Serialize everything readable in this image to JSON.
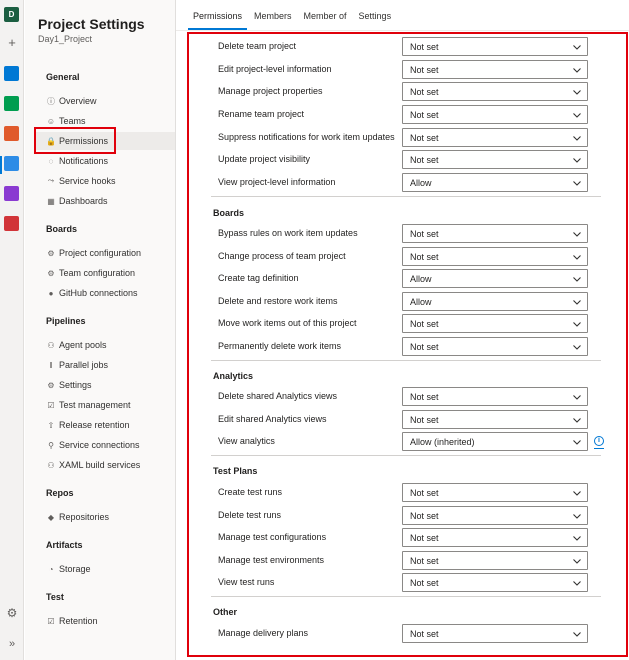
{
  "rail": {
    "org_initial": "D",
    "plus_glyph": "+",
    "gear_glyph": "⚙",
    "expand_glyph": "»",
    "apps": [
      {
        "name": "overview-app-icon",
        "color": "#0078d4"
      },
      {
        "name": "boards-app-icon",
        "color": "#009d4f"
      },
      {
        "name": "repos-app-icon",
        "color": "#e05a2b"
      },
      {
        "name": "pipelines-app-icon",
        "color": "#2d8ce6"
      },
      {
        "name": "test-plans-app-icon",
        "color": "#8a3ad1"
      },
      {
        "name": "artifacts-app-icon",
        "color": "#d13438"
      }
    ]
  },
  "sidebar": {
    "title": "Project Settings",
    "subtitle": "Day1_Project",
    "sections": {
      "general": "General",
      "boards": "Boards",
      "pipelines": "Pipelines",
      "repos": "Repos",
      "artifacts": "Artifacts",
      "test": "Test"
    },
    "items": {
      "overview": {
        "label": "Overview",
        "icon": "ⓘ"
      },
      "teams": {
        "label": "Teams",
        "icon": "☺"
      },
      "permissions": {
        "label": "Permissions",
        "icon": "🔒"
      },
      "notifications": {
        "label": "Notifications",
        "icon": "◌"
      },
      "service_hooks": {
        "label": "Service hooks",
        "icon": "⤳"
      },
      "dashboards": {
        "label": "Dashboards",
        "icon": "▦"
      },
      "project_configuration": {
        "label": "Project configuration",
        "icon": "⚙"
      },
      "team_configuration": {
        "label": "Team configuration",
        "icon": "⚙"
      },
      "github_connections": {
        "label": "GitHub connections",
        "icon": "●"
      },
      "agent_pools": {
        "label": "Agent pools",
        "icon": "⚇"
      },
      "parallel_jobs": {
        "label": "Parallel jobs",
        "icon": "‖"
      },
      "settings": {
        "label": "Settings",
        "icon": "⚙"
      },
      "test_management": {
        "label": "Test management",
        "icon": "☑"
      },
      "release_retention": {
        "label": "Release retention",
        "icon": "⇧"
      },
      "service_connections": {
        "label": "Service connections",
        "icon": "⚲"
      },
      "xaml_build_services": {
        "label": "XAML build services",
        "icon": "⚇"
      },
      "repositories": {
        "label": "Repositories",
        "icon": "◆"
      },
      "storage": {
        "label": "Storage",
        "icon": "◔"
      },
      "retention": {
        "label": "Retention",
        "icon": "☑"
      }
    }
  },
  "tabs": [
    "Permissions",
    "Members",
    "Member of",
    "Settings"
  ],
  "permissions": {
    "project": [
      {
        "label": "Delete team project",
        "value": "Not set"
      },
      {
        "label": "Edit project-level information",
        "value": "Not set"
      },
      {
        "label": "Manage project properties",
        "value": "Not set"
      },
      {
        "label": "Rename team project",
        "value": "Not set"
      },
      {
        "label": "Suppress notifications for work item updates",
        "value": "Not set"
      },
      {
        "label": "Update project visibility",
        "value": "Not set"
      },
      {
        "label": "View project-level information",
        "value": "Allow"
      }
    ],
    "boards_title": "Boards",
    "boards": [
      {
        "label": "Bypass rules on work item updates",
        "value": "Not set"
      },
      {
        "label": "Change process of team project",
        "value": "Not set"
      },
      {
        "label": "Create tag definition",
        "value": "Allow"
      },
      {
        "label": "Delete and restore work items",
        "value": "Allow"
      },
      {
        "label": "Move work items out of this project",
        "value": "Not set"
      },
      {
        "label": "Permanently delete work items",
        "value": "Not set"
      }
    ],
    "analytics_title": "Analytics",
    "analytics": [
      {
        "label": "Delete shared Analytics views",
        "value": "Not set"
      },
      {
        "label": "Edit shared Analytics views",
        "value": "Not set"
      },
      {
        "label": "View analytics",
        "value": "Allow (inherited)"
      }
    ],
    "test_plans_title": "Test Plans",
    "test_plans": [
      {
        "label": "Create test runs",
        "value": "Not set"
      },
      {
        "label": "Delete test runs",
        "value": "Not set"
      },
      {
        "label": "Manage test configurations",
        "value": "Not set"
      },
      {
        "label": "Manage test environments",
        "value": "Not set"
      },
      {
        "label": "View test runs",
        "value": "Not set"
      }
    ],
    "other_title": "Other",
    "other": [
      {
        "label": "Manage delivery plans",
        "value": "Not set"
      }
    ]
  },
  "info_glyph": "i",
  "colors": {
    "accent": "#0078d4",
    "highlight": "#e0000b"
  }
}
